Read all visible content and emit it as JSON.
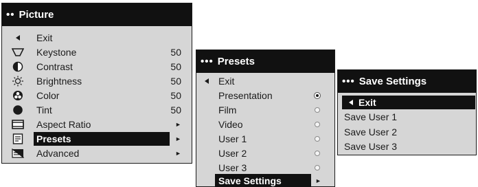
{
  "picture_menu": {
    "title": "Picture",
    "items": [
      {
        "label": "Exit",
        "value": ""
      },
      {
        "label": "Keystone",
        "value": "50"
      },
      {
        "label": "Contrast",
        "value": "50"
      },
      {
        "label": "Brightness",
        "value": "50"
      },
      {
        "label": "Color",
        "value": "50"
      },
      {
        "label": "Tint",
        "value": "50"
      },
      {
        "label": "Aspect Ratio",
        "value": ""
      },
      {
        "label": "Presets",
        "value": ""
      },
      {
        "label": "Advanced",
        "value": ""
      }
    ],
    "submenu_arrow": "►"
  },
  "presets_menu": {
    "title": "Presets",
    "items": [
      {
        "label": "Exit",
        "selected": false
      },
      {
        "label": "Presentation",
        "selected": true
      },
      {
        "label": "Film",
        "selected": false
      },
      {
        "label": "Video",
        "selected": false
      },
      {
        "label": "User 1",
        "selected": false
      },
      {
        "label": "User 2",
        "selected": false
      },
      {
        "label": "User 3",
        "selected": false
      },
      {
        "label": "Save Settings",
        "selected": false
      }
    ]
  },
  "save_menu": {
    "title": "Save Settings",
    "items": [
      {
        "label": "Exit"
      },
      {
        "label": "Save User 1"
      },
      {
        "label": "Save User 2"
      },
      {
        "label": "Save User 3"
      }
    ]
  },
  "header_dots": {
    "two": "••",
    "three": "•••"
  },
  "colors": {
    "header_bg": "#111111",
    "menu_bg": "#d6d6d6",
    "highlight": "#111111",
    "text": "#1a1a1a"
  },
  "icons": [
    "back-arrow-icon",
    "keystone-icon",
    "contrast-icon",
    "brightness-icon",
    "color-icon",
    "tint-icon",
    "aspect-ratio-icon",
    "presets-icon",
    "advanced-icon"
  ]
}
